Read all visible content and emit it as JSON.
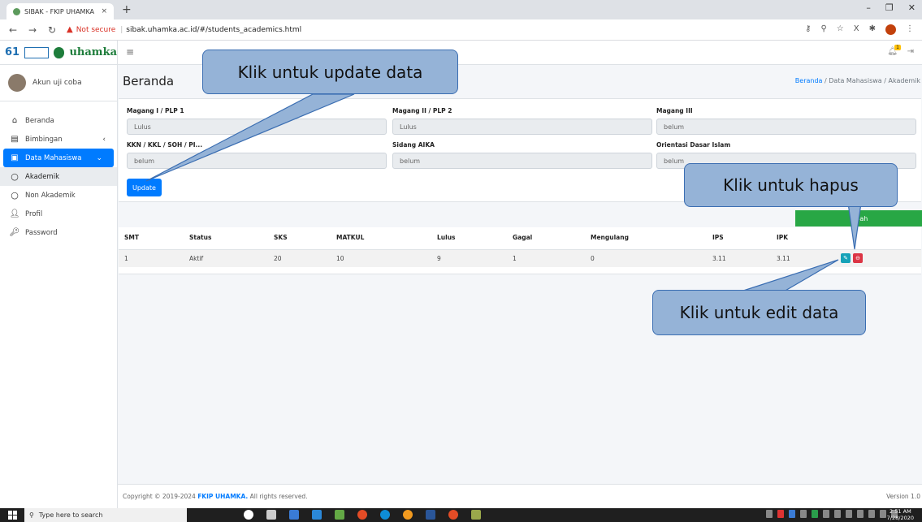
{
  "browser": {
    "tab_title": "SIBAK - FKIP UHAMKA",
    "not_secure": "Not secure",
    "url": "sibak.uhamka.ac.id/#/students_academics.html"
  },
  "header": {
    "logo_mark": "61",
    "logo_text": "uhamka",
    "notification_count": "1"
  },
  "sidebar": {
    "user_name": "Akun uji coba",
    "items": [
      {
        "label": "Beranda",
        "icon": "home-icon"
      },
      {
        "label": "Bimbingan",
        "icon": "book-icon"
      },
      {
        "label": "Data Mahasiswa",
        "icon": "id-card-icon"
      },
      {
        "label": "Akademik",
        "icon": "circle-icon"
      },
      {
        "label": "Non Akademik",
        "icon": "circle-icon"
      },
      {
        "label": "Profil",
        "icon": "user-icon"
      },
      {
        "label": "Password",
        "icon": "key-icon"
      }
    ]
  },
  "page": {
    "title": "Beranda",
    "breadcrumb": [
      "Beranda",
      "Data Mahasiswa",
      "Akademik"
    ]
  },
  "form": {
    "fields": [
      {
        "label": "Magang I / PLP 1",
        "value": "Lulus"
      },
      {
        "label": "Magang II / PLP 2",
        "value": "Lulus"
      },
      {
        "label": "Magang III",
        "value": "belum"
      },
      {
        "label": "KKN / KKL / SOH / PI...",
        "value": "belum"
      },
      {
        "label": "Sidang AIKA",
        "value": "belum"
      },
      {
        "label": "Orientasi Dasar Islam",
        "value": "belum"
      }
    ],
    "update_label": "Update"
  },
  "table": {
    "add_label": "...bah",
    "headers": [
      "SMT",
      "Status",
      "SKS",
      "MATKUL",
      "Lulus",
      "Gagal",
      "Mengulang",
      "IPS",
      "IPK"
    ],
    "rows": [
      [
        "1",
        "Aktif",
        "20",
        "10",
        "9",
        "1",
        "0",
        "3.11",
        "3.11"
      ]
    ]
  },
  "footer": {
    "copyright_prefix": "Copyright © 2019-2024 ",
    "org": "FKIP UHAMKA.",
    "rights": " All rights reserved.",
    "version": "Version 1.0"
  },
  "callouts": {
    "update": "Klik untuk update data",
    "delete": "Klik untuk hapus",
    "edit": "Klik untuk edit data"
  },
  "taskbar": {
    "search_placeholder": "Type here to search",
    "time": "2:51 AM",
    "date": "7/28/2020"
  }
}
